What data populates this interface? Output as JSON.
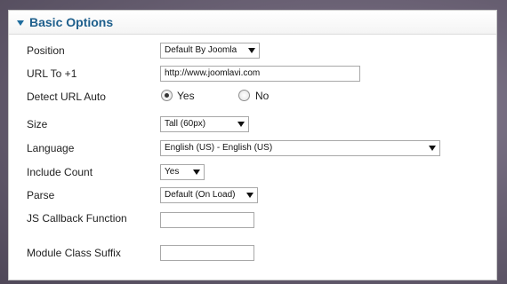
{
  "panel": {
    "title": "Basic Options"
  },
  "fields": {
    "position": {
      "label": "Position",
      "value": "Default By Joomla"
    },
    "url": {
      "label": "URL To +1",
      "value": "http://www.joomlavi.com"
    },
    "detect_url": {
      "label": "Detect URL Auto",
      "yes": "Yes",
      "no": "No",
      "selected": "Yes"
    },
    "size": {
      "label": "Size",
      "value": "Tall (60px)"
    },
    "language": {
      "label": "Language",
      "value": "English (US) - English (US)"
    },
    "include_count": {
      "label": "Include Count",
      "value": "Yes"
    },
    "parse": {
      "label": "Parse",
      "value": "Default (On Load)"
    },
    "js_callback": {
      "label": "JS Callback Function",
      "value": ""
    },
    "module_suffix": {
      "label": "Module Class Suffix",
      "value": ""
    }
  }
}
